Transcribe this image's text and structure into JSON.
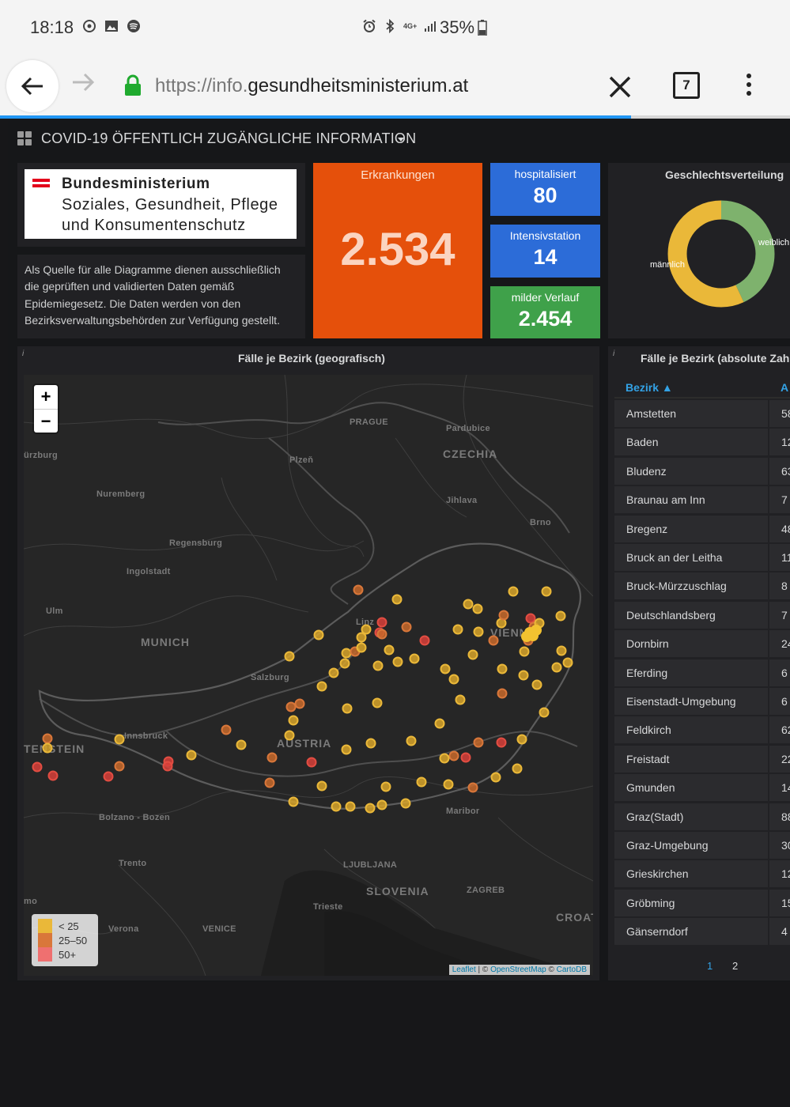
{
  "status_bar": {
    "time": "18:18",
    "battery": "35%",
    "network": "4G+"
  },
  "browser": {
    "url_prefix": "https://info.",
    "url_domain": "gesundheitsministerium.at",
    "tab_count": "7",
    "load_progress": 0.8
  },
  "dashboard": {
    "title": "COVID-19 ÖFFENTLICH ZUGÄNGLICHE INFORMATION"
  },
  "logo": {
    "line1": "Bundesministerium",
    "line2": "Soziales, Gesundheit, Pflege",
    "line3": "und Konsumentenschutz",
    "flag_colors": [
      "#e3001b",
      "#ffffff",
      "#e3001b"
    ]
  },
  "info_text": "Als Quelle für alle Diagramme dienen ausschließlich die geprüften und validierten Daten gemäß Epidemiegesetz. Die Daten werden von den Bezirksverwaltungsbehörden zur Verfügung gestellt.",
  "stats": {
    "erkrankungen": {
      "label": "Erkrankungen",
      "value": "2.534",
      "color": "#e5500b"
    },
    "hospitalisiert": {
      "label": "hospitalisiert",
      "value": "80",
      "color": "#2c6cd8"
    },
    "intensivstation": {
      "label": "Intensivstation",
      "value": "14",
      "color": "#2c6cd8"
    },
    "milder_verlauf": {
      "label": "milder Verlauf",
      "value": "2.454",
      "color": "#3fa14a"
    }
  },
  "gender": {
    "title": "Geschlechtsverteilung",
    "female_label": "weiblich",
    "male_label": "männlich",
    "female_share": 0.43,
    "male_share": 0.57,
    "female_color": "#7eb26d",
    "male_color": "#eab839"
  },
  "map": {
    "title": "Fälle je Bezirk (geografisch)",
    "zoom_in": "+",
    "zoom_out": "−",
    "labels": {
      "prague": "PRAGUE",
      "pardubice": "Pardubice",
      "czechia": "CZECHIA",
      "wurzburg": "ürzburg",
      "plzen": "Plzeň",
      "nuremberg": "Nuremberg",
      "jihlava": "Jihlava",
      "brno": "Brno",
      "regensburg": "Regensburg",
      "ingolstadt": "Ingolstadt",
      "ulm": "Ulm",
      "munich": "MUNICH",
      "salzburg": "Salzburg",
      "vienna": "VIENN",
      "linz": "Linz",
      "innsbruck": "Innsbruck",
      "austria": "AUSTRIA",
      "liechtenstein": "TENSTEIN",
      "bolzano": "Bolzano - Bozen",
      "maribor": "Maribor",
      "trento": "Trento",
      "ljubljana": "LJUBLJANA",
      "slovenia": "SLOVENIA",
      "zagreb": "ZAGREB",
      "trieste": "Trieste",
      "verona": "Verona",
      "venice": "VENICE",
      "croat": "CROAT",
      "como": "mo"
    },
    "legend": [
      {
        "label": "< 25",
        "color": "#eab839"
      },
      {
        "label": "25–50",
        "color": "#ef843c"
      },
      {
        "label": "50+",
        "color": "#e24d42"
      }
    ],
    "attribution": {
      "leaflet": "Leaflet",
      "sep": " | © ",
      "osm": "OpenStreetMap",
      "c": " © ",
      "carto": "CartoDB"
    }
  },
  "district_table": {
    "title": "Fälle je Bezirk (absolute Zahlen)",
    "columns": [
      "Bezirk ▲",
      "A"
    ],
    "rows": [
      {
        "bezirk": "Amstetten",
        "anzahl": "58"
      },
      {
        "bezirk": "Baden",
        "anzahl": "12"
      },
      {
        "bezirk": "Bludenz",
        "anzahl": "63"
      },
      {
        "bezirk": "Braunau am Inn",
        "anzahl": "7"
      },
      {
        "bezirk": "Bregenz",
        "anzahl": "48"
      },
      {
        "bezirk": "Bruck an der Leitha",
        "anzahl": "11"
      },
      {
        "bezirk": "Bruck-Mürzzuschlag",
        "anzahl": "8"
      },
      {
        "bezirk": "Deutschlandsberg",
        "anzahl": "7"
      },
      {
        "bezirk": "Dornbirn",
        "anzahl": "24"
      },
      {
        "bezirk": "Eferding",
        "anzahl": "6"
      },
      {
        "bezirk": "Eisenstadt-Umgebung",
        "anzahl": "6"
      },
      {
        "bezirk": "Feldkirch",
        "anzahl": "62"
      },
      {
        "bezirk": "Freistadt",
        "anzahl": "22"
      },
      {
        "bezirk": "Gmunden",
        "anzahl": "14"
      },
      {
        "bezirk": "Graz(Stadt)",
        "anzahl": "88"
      },
      {
        "bezirk": "Graz-Umgebung",
        "anzahl": "30"
      },
      {
        "bezirk": "Grieskirchen",
        "anzahl": "12"
      },
      {
        "bezirk": "Gröbming",
        "anzahl": "15"
      },
      {
        "bezirk": "Gänserndorf",
        "anzahl": "4"
      }
    ],
    "pages": [
      "1",
      "2"
    ]
  }
}
